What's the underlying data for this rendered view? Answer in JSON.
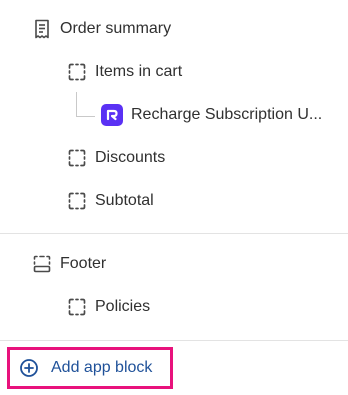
{
  "tree": {
    "order_summary": {
      "label": "Order summary",
      "icon": "receipt-icon"
    },
    "items_in_cart": {
      "label": "Items in cart",
      "icon": "block-outline-icon"
    },
    "app_block": {
      "label": "Recharge Subscription U...",
      "icon": "recharge-app-logo",
      "logo_color": "#5a31f4"
    },
    "discounts": {
      "label": "Discounts",
      "icon": "block-outline-icon"
    },
    "subtotal": {
      "label": "Subtotal",
      "icon": "block-outline-icon"
    },
    "footer": {
      "label": "Footer",
      "icon": "footer-layout-icon"
    },
    "policies": {
      "label": "Policies",
      "icon": "block-outline-icon"
    }
  },
  "add_app_block": {
    "label": "Add app block",
    "icon": "plus-circle-icon",
    "color": "#1f5199",
    "highlight_color": "#e8127c"
  }
}
